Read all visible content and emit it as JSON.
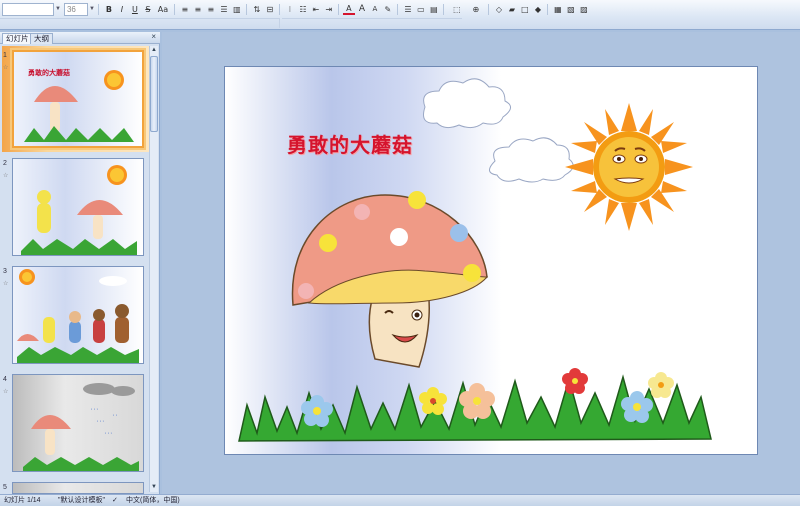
{
  "toolbar": {
    "font_name": "",
    "font_size": "36",
    "bold": "B",
    "italic": "I",
    "underline": "U",
    "strike": "S",
    "char_spacing": "Aa",
    "font_grow": "A",
    "font_shrink": "A"
  },
  "left_pane": {
    "tabs": [
      "幻灯片",
      "大纲"
    ],
    "close": "×",
    "slides": [
      {
        "number": "1",
        "title": "勇敢的大蘑菇",
        "selected": true
      },
      {
        "number": "2"
      },
      {
        "number": "3"
      },
      {
        "number": "4"
      },
      {
        "number": "5"
      }
    ]
  },
  "slide": {
    "title": "勇敢的大蘑菇"
  },
  "status_bar": {
    "slide_count": "幻灯片 1/14",
    "theme": "\"默认设计模板\"",
    "language": "中文(简体，中国)"
  },
  "colors": {
    "title_red": "#d5142d",
    "ribbon_blue": "#dbe6f4",
    "selection_orange": "#f2a33c"
  }
}
